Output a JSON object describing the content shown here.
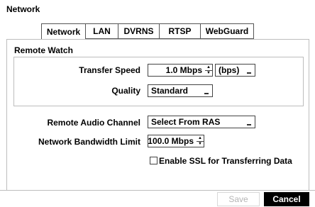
{
  "window": {
    "title": "Network"
  },
  "tabs": [
    {
      "label": "Network",
      "active": true
    },
    {
      "label": "LAN",
      "active": false
    },
    {
      "label": "DVRNS",
      "active": false
    },
    {
      "label": "RTSP",
      "active": false
    },
    {
      "label": "WebGuard",
      "active": false
    }
  ],
  "remote_watch": {
    "section_title": "Remote Watch",
    "transfer_speed": {
      "label": "Transfer Speed",
      "value": "1.0 Mbps",
      "unit": "(bps)"
    },
    "quality": {
      "label": "Quality",
      "value": "Standard"
    }
  },
  "remote_audio_channel": {
    "label": "Remote Audio Channel",
    "value": "Select From RAS"
  },
  "network_bandwidth_limit": {
    "label": "Network Bandwidth Limit",
    "value": "100.0 Mbps"
  },
  "enable_ssl": {
    "label": "Enable SSL for Transferring Data",
    "checked": false
  },
  "buttons": {
    "save": "Save",
    "cancel": "Cancel"
  },
  "icons": {
    "spinner_up": "spinner-up-icon",
    "spinner_down": "spinner-down-icon",
    "dropdown": "dropdown-arrow-icon"
  }
}
